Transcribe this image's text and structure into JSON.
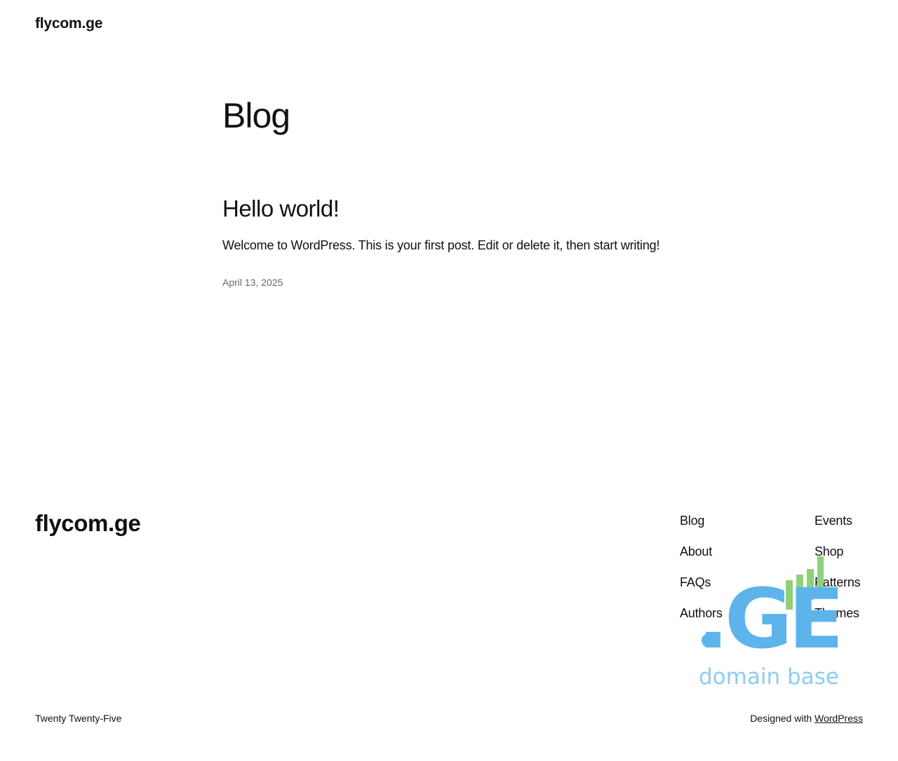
{
  "header": {
    "site_title": "flycom.ge"
  },
  "main": {
    "page_title": "Blog",
    "posts": [
      {
        "title": "Hello world!",
        "excerpt": "Welcome to WordPress. This is your first post. Edit or delete it, then start writing!",
        "date": "April 13, 2025"
      }
    ]
  },
  "footer": {
    "site_title": "flycom.ge",
    "nav_col1": [
      "Blog",
      "About",
      "FAQs",
      "Authors"
    ],
    "nav_col2": [
      "Events",
      "Shop",
      "Patterns",
      "Themes"
    ],
    "theme_name": "Twenty Twenty-Five",
    "designed_with_label": "Designed with",
    "designed_with_link": "WordPress"
  },
  "overlay_logo": {
    "icon": "ge-domain-base-logo",
    "mark_text": ".GE",
    "tagline": "domain base",
    "colors": {
      "blue": "#5DB4EB",
      "green": "#8FD07A",
      "tagline": "#8ECDF2"
    }
  }
}
